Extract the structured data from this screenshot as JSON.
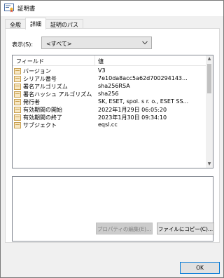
{
  "window": {
    "title": "証明書"
  },
  "tabs": [
    {
      "label": "全般"
    },
    {
      "label": "詳細"
    },
    {
      "label": "証明のパス"
    }
  ],
  "show": {
    "label": "表示(S):",
    "selected": "<すべて>"
  },
  "list": {
    "col_field": "フィールド",
    "col_value": "値",
    "rows": [
      {
        "field": "バージョン",
        "value": "V3"
      },
      {
        "field": "シリアル番号",
        "value": "7e10da8acc5a62d700294143..."
      },
      {
        "field": "署名アルゴリズム",
        "value": "sha256RSA"
      },
      {
        "field": "署名ハッシュ アルゴリズム",
        "value": "sha256"
      },
      {
        "field": "発行者",
        "value": "SK, ESET, spol. s r. o., ESET SS..."
      },
      {
        "field": "有効期間の開始",
        "value": "2022年1月29日 06:05:20"
      },
      {
        "field": "有効期間の終了",
        "value": "2023年1月30日 09:34:10"
      },
      {
        "field": "サブジェクト",
        "value": "eqsl.cc"
      }
    ]
  },
  "buttons": {
    "edit_properties": "プロパティの編集(E)...",
    "copy_to_file": "ファイルにコピー(C)...",
    "ok": "OK"
  },
  "colors": {
    "window_bg": "#f0f0f0",
    "panel_bg": "#ffffff",
    "ok_border": "#0078d7",
    "icon_fill": "#f7e7c3",
    "icon_stroke": "#c8a050"
  }
}
